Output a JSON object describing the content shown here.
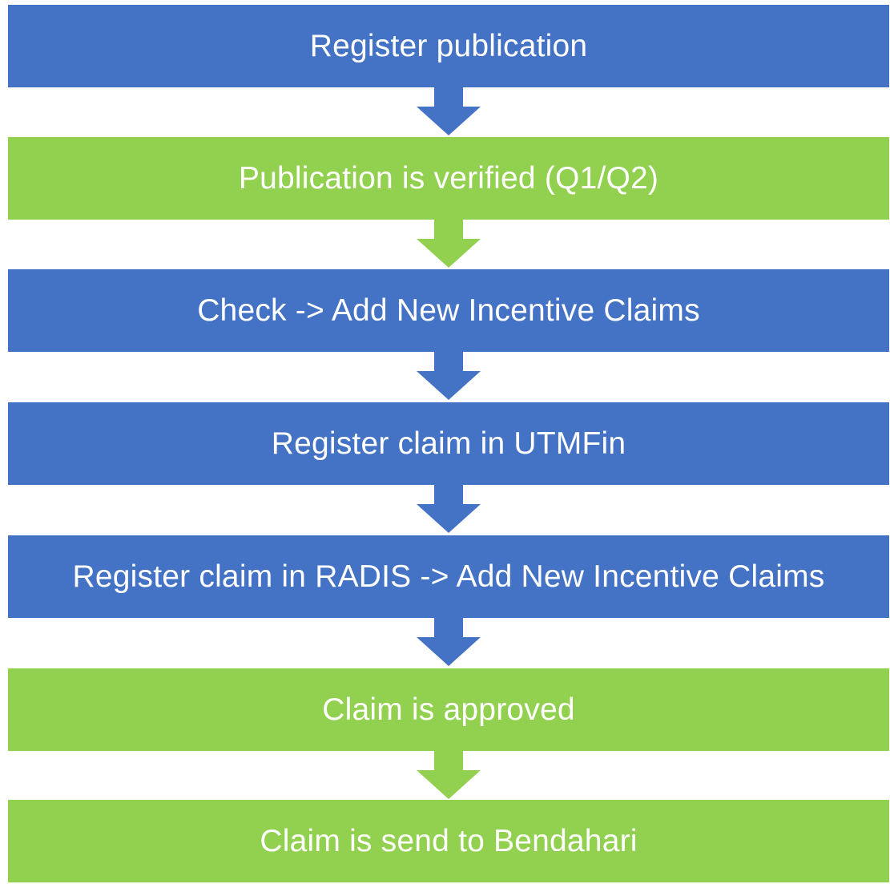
{
  "colors": {
    "blue": "#4472c4",
    "green": "#92d050"
  },
  "steps": [
    {
      "label": "Register publication",
      "color": "blue"
    },
    {
      "label": "Publication is verified (Q1/Q2)",
      "color": "green"
    },
    {
      "label": "Check -> Add New Incentive Claims",
      "color": "blue"
    },
    {
      "label": "Register claim in UTMFin",
      "color": "blue"
    },
    {
      "label": "Register claim in RADIS -> Add New Incentive Claims",
      "color": "blue"
    },
    {
      "label": "Claim is approved",
      "color": "green"
    },
    {
      "label": "Claim is send to Bendahari",
      "color": "green"
    }
  ],
  "arrows": [
    {
      "color": "blue",
      "icon": "down-arrow-icon"
    },
    {
      "color": "green",
      "icon": "down-arrow-icon"
    },
    {
      "color": "blue",
      "icon": "down-arrow-icon"
    },
    {
      "color": "blue",
      "icon": "down-arrow-icon"
    },
    {
      "color": "blue",
      "icon": "down-arrow-icon"
    },
    {
      "color": "green",
      "icon": "down-arrow-icon"
    }
  ]
}
